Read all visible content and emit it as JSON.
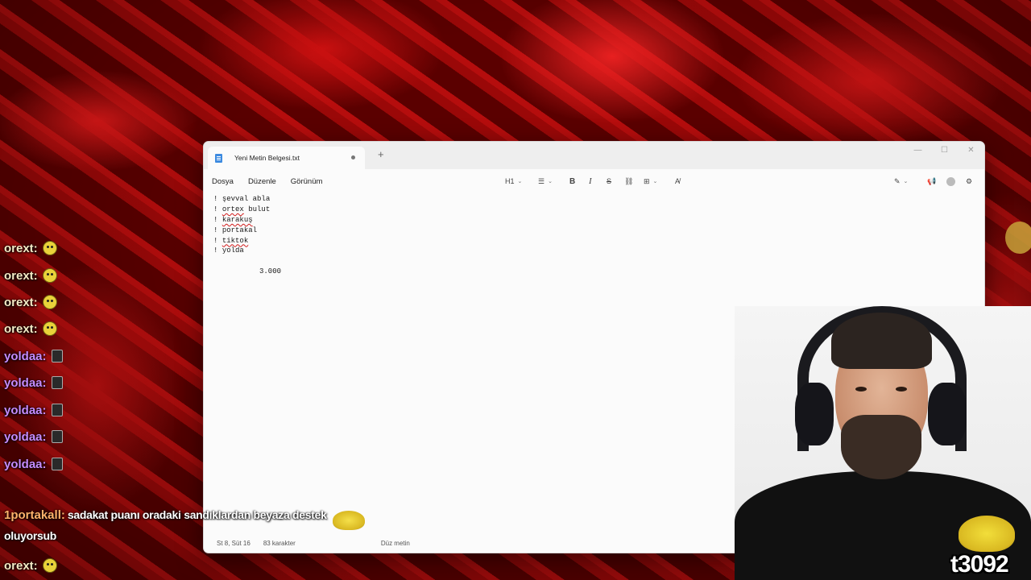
{
  "notepad": {
    "tab_title": "Yeni Metin Belgesi.txt",
    "tab_add": "+",
    "window_controls": [
      "minimize-icon",
      "maximize-icon",
      "close-icon"
    ],
    "menu": [
      "Dosya",
      "Düzenle",
      "Görünüm"
    ],
    "toolbar": {
      "heading": "H1",
      "list_icon": "list-icon",
      "bold": "B",
      "italic": "I",
      "strike": "S",
      "link_icon": "link-icon",
      "table_icon": "table-icon",
      "clear_format_icon": "clear-format-icon",
      "copilot_icon": "copilot-icon",
      "share_icon": "share-icon",
      "account_icon": "account-icon",
      "settings_icon": "settings-icon"
    },
    "lines": [
      {
        "prefix": "! ",
        "word": "şevval",
        "rest": " abla",
        "flag": false
      },
      {
        "prefix": "! ",
        "word": "ortex",
        "rest": " bulut",
        "flag": true
      },
      {
        "prefix": "! ",
        "word": "karakuş",
        "rest": "",
        "flag": true
      },
      {
        "prefix": "! ",
        "word": "portakal",
        "rest": "",
        "flag": false
      },
      {
        "prefix": "! ",
        "word": "tiktok",
        "rest": "",
        "flag": true
      },
      {
        "prefix": "! ",
        "word": "yolda",
        "rest": "",
        "flag": false
      }
    ],
    "amount": "3.000",
    "status": {
      "position": "St 8, Süt 16",
      "chars": "83 karakter",
      "format": "Düz metin"
    }
  },
  "chat": [
    {
      "user": "orext:",
      "color": "#f3e9c4",
      "emote": "smile"
    },
    {
      "user": "orext:",
      "color": "#f3e9c4",
      "emote": "smile"
    },
    {
      "user": "orext:",
      "color": "#f3e9c4",
      "emote": "smile"
    },
    {
      "user": "orext:",
      "color": "#f3e9c4",
      "emote": "smile"
    },
    {
      "user": "yoldaa:",
      "color": "#c58cff",
      "emote": "w"
    },
    {
      "user": "yoldaa:",
      "color": "#c58cff",
      "emote": "w"
    },
    {
      "user": "yoldaa:",
      "color": "#c58cff",
      "emote": "w"
    },
    {
      "user": "yoldaa:",
      "color": "#c58cff",
      "emote": "w"
    },
    {
      "user": "yoldaa:",
      "color": "#c58cff",
      "emote": "w"
    }
  ],
  "chat_message": {
    "user": "1portakall:",
    "user_color": "#ffb36b",
    "text_line1": "sadakat puanı oradaki sandıklardan beyaza destek",
    "text_line2": "oluyorsub"
  },
  "chat_last": {
    "user": "orext:",
    "color": "#f3e9c4"
  },
  "overlay_text": "t3092"
}
